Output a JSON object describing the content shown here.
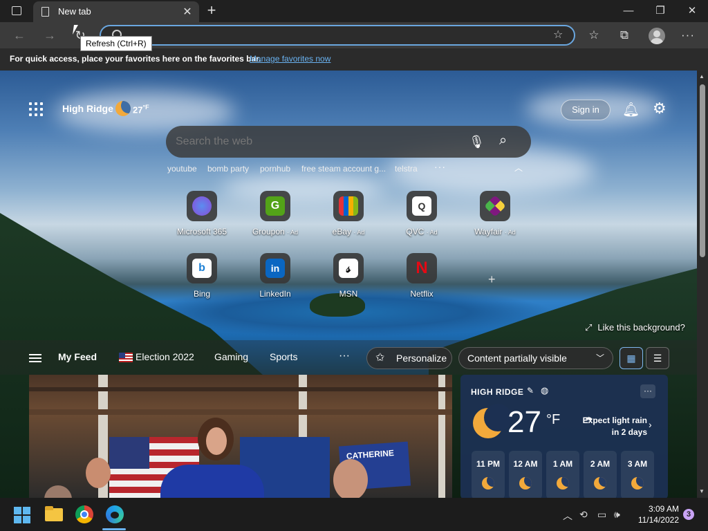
{
  "browser": {
    "tab_title": "New tab",
    "address_value": "",
    "tooltip": "Refresh (Ctrl+R)",
    "favorites_message": "For quick access, place your favorites here on the favorites bar.",
    "favorites_link": "Manage favorites now"
  },
  "ntp": {
    "location": "High Ridge",
    "temp": "27",
    "unit": "°F",
    "sign_in": "Sign in",
    "search_placeholder": "Search the web",
    "trending": [
      "youtube",
      "bomb party",
      "pornhub",
      "free steam account g...",
      "telstra"
    ],
    "tiles_row1": [
      {
        "label": "Microsoft 365",
        "ad": "",
        "icon": "microsoft-365-icon",
        "color": "#7b5cd6"
      },
      {
        "label": "Groupon",
        "ad": "· Ad",
        "icon": "groupon-icon",
        "color": "#53a318"
      },
      {
        "label": "eBay",
        "ad": "· Ad",
        "icon": "ebay-icon",
        "color": "#e53238"
      },
      {
        "label": "QVC",
        "ad": "· Ad",
        "icon": "qvc-icon",
        "color": "#ffffff"
      },
      {
        "label": "Wayfair",
        "ad": "· Ad",
        "icon": "wayfair-icon",
        "color": "#7f187f"
      }
    ],
    "tiles_row2": [
      {
        "label": "Bing",
        "ad": "",
        "icon": "bing-icon",
        "color": "#ffffff"
      },
      {
        "label": "LinkedIn",
        "ad": "",
        "icon": "linkedin-icon",
        "color": "#0a66c2"
      },
      {
        "label": "MSN",
        "ad": "",
        "icon": "msn-icon",
        "color": "#ffffff"
      },
      {
        "label": "Netflix",
        "ad": "",
        "icon": "netflix-icon",
        "color": "#e50914"
      }
    ],
    "background_prompt": "Like this background?"
  },
  "feed": {
    "my_feed": "My Feed",
    "election": "Election 2022",
    "gaming": "Gaming",
    "sports": "Sports",
    "personalize": "Personalize",
    "visibility": "Content partially visible"
  },
  "news": {
    "sign_text": "CATHERINE"
  },
  "weather": {
    "location": "HIGH RIDGE",
    "temp": "27",
    "unit": "°F",
    "note": "Expect light rain in 2 days",
    "hours": [
      "11 PM",
      "12 AM",
      "1 AM",
      "2 AM",
      "3 AM"
    ]
  },
  "taskbar": {
    "time": "3:09 AM",
    "date": "11/14/2022",
    "notifications": "3"
  }
}
